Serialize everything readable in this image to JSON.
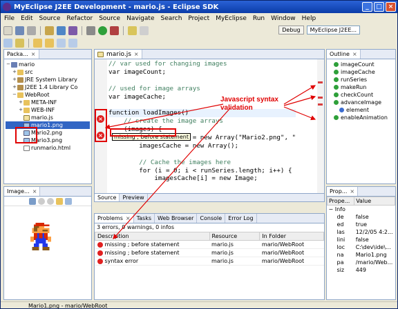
{
  "window": {
    "title": "MyEclipse J2EE Development - mario.js - Eclipse SDK"
  },
  "menu": [
    "File",
    "Edit",
    "Source",
    "Refactor",
    "Source",
    "Navigate",
    "Search",
    "Project",
    "MyEclipse",
    "Run",
    "Window",
    "Help"
  ],
  "perspectives": {
    "debug": "Debug",
    "myeclipse": "MyEclipse J2EE..."
  },
  "package_explorer": {
    "tab": "Packa...",
    "tree": [
      {
        "label": "mario",
        "indent": 0,
        "icon": "proj",
        "exp": "−"
      },
      {
        "label": "src",
        "indent": 1,
        "icon": "folder",
        "exp": "+"
      },
      {
        "label": "JRE System Library",
        "indent": 1,
        "icon": "lib",
        "exp": "+"
      },
      {
        "label": "J2EE 1.4 Library Co",
        "indent": 1,
        "icon": "lib",
        "exp": "+"
      },
      {
        "label": "WebRoot",
        "indent": 1,
        "icon": "folder",
        "exp": "−"
      },
      {
        "label": "META-INF",
        "indent": 2,
        "icon": "folder",
        "exp": "+"
      },
      {
        "label": "WEB-INF",
        "indent": 2,
        "icon": "folder",
        "exp": "+"
      },
      {
        "label": "mario.js",
        "indent": 2,
        "icon": "js",
        "exp": ""
      },
      {
        "label": "mario1.png",
        "indent": 2,
        "icon": "png",
        "exp": "",
        "selected": true
      },
      {
        "label": "Mario2.png",
        "indent": 2,
        "icon": "png",
        "exp": ""
      },
      {
        "label": "Mario3.png",
        "indent": 2,
        "icon": "png",
        "exp": ""
      },
      {
        "label": "runmario.html",
        "indent": 2,
        "icon": "file",
        "exp": ""
      }
    ]
  },
  "editor": {
    "tab": "mario.js",
    "lines": [
      "// var used for changing images",
      "var imageCount;",
      "",
      "// used for image arrays",
      "var imageCache;",
      "",
      "function loadImages()",
      "    // create the image arrays",
      "    (images) {",
      "        var runSeries = new Array(\"Mario2.png\", \"",
      "        imagesCache = new Array();",
      "",
      "        // Cache the images here",
      "        for (i = 0; i < runSeries.length; i++) {",
      "            imagesCache[i] = new Image;"
    ],
    "hover": "missing ; before statement",
    "bottom_tabs": [
      "Source",
      "Preview"
    ]
  },
  "outline": {
    "tab": "Outline",
    "items": [
      {
        "label": "imageCount",
        "indent": 1
      },
      {
        "label": "imageCache",
        "indent": 1
      },
      {
        "label": "runSeries",
        "indent": 1
      },
      {
        "label": "makeRun",
        "indent": 1
      },
      {
        "label": "checkCount",
        "indent": 1
      },
      {
        "label": "advanceImage",
        "indent": 1
      },
      {
        "label": "element",
        "indent": 2
      },
      {
        "label": "enableAnimation",
        "indent": 1
      }
    ]
  },
  "image_view": {
    "tab": "Image..."
  },
  "problems": {
    "tabs": [
      "Problems",
      "Tasks",
      "Web Browser",
      "Console",
      "Error Log"
    ],
    "summary": "3 errors, 0 warnings, 0 infos",
    "columns": [
      "Description",
      "Resource",
      "In Folder"
    ],
    "rows": [
      {
        "description": "missing ; before statement",
        "resource": "mario.js",
        "folder": "mario/WebRoot"
      },
      {
        "description": "missing ; before statement",
        "resource": "mario.js",
        "folder": "mario/WebRoot"
      },
      {
        "description": "syntax error",
        "resource": "mario.js",
        "folder": "mario/WebRoot"
      }
    ]
  },
  "properties": {
    "tab": "Prop...",
    "columns": [
      "Prope...",
      "Value"
    ],
    "group": "Info",
    "rows": [
      {
        "name": "de",
        "value": "false"
      },
      {
        "name": "ed",
        "value": "true"
      },
      {
        "name": "las",
        "value": "12/2/05 4:2..."
      },
      {
        "name": "lini",
        "value": "false"
      },
      {
        "name": "loc",
        "value": "C:\\dev\\ide\\..."
      },
      {
        "name": "na",
        "value": "Mario1.png"
      },
      {
        "name": "pa",
        "value": "/mario/Web..."
      },
      {
        "name": "siz",
        "value": "449"
      }
    ]
  },
  "status": "Mario1.png - mario/WebRoot",
  "annotation": {
    "line1": "Javascript syntax",
    "line2": "validation"
  },
  "colors": {
    "annotation": "#e00000",
    "error": "#e02020",
    "title": "#0b3ca8"
  }
}
